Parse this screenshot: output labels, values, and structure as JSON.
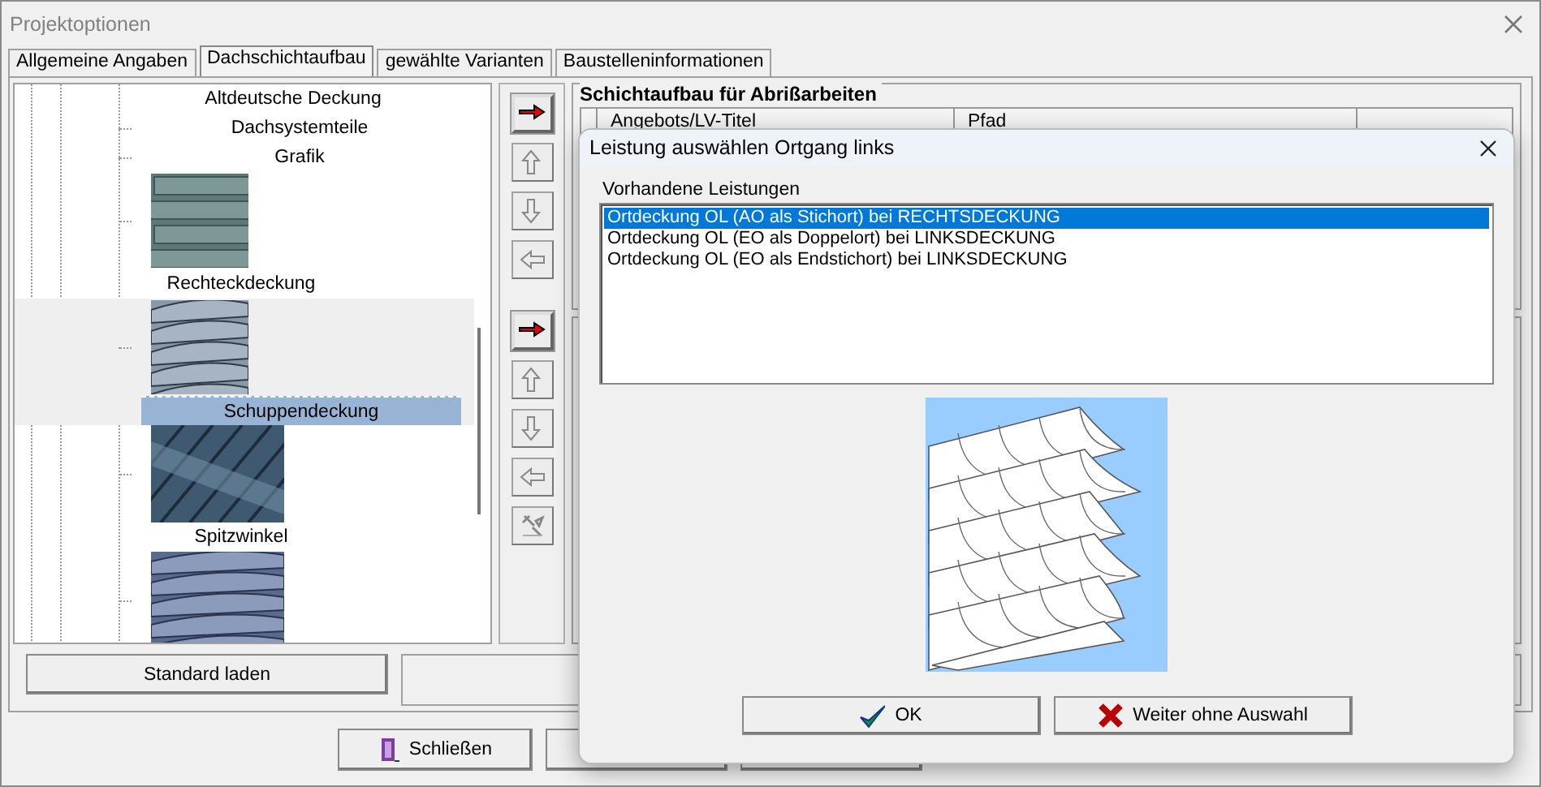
{
  "window": {
    "title": "Projektoptionen"
  },
  "tabs": [
    {
      "label": "Allgemeine Angaben",
      "selected": false
    },
    {
      "label": "Dachschichtaufbau",
      "selected": true
    },
    {
      "label": "gewählte Varianten",
      "selected": false
    },
    {
      "label": "Baustelleninformationen",
      "selected": false
    }
  ],
  "tree": {
    "items": [
      {
        "kind": "label",
        "label": "Altdeutsche Deckung",
        "selected": false
      },
      {
        "kind": "node",
        "label": "Dachsystemteile",
        "selected": false
      },
      {
        "kind": "node",
        "label": "Grafik",
        "selected": false
      },
      {
        "kind": "entry",
        "label": "Rechteckdeckung",
        "selected": false
      },
      {
        "kind": "entry",
        "label": "Schuppendeckung",
        "selected": true
      },
      {
        "kind": "entry",
        "label": "Spitzwinkel",
        "selected": false
      },
      {
        "kind": "picture",
        "selected": false
      }
    ]
  },
  "side_buttons": [
    {
      "kind": "add",
      "disabled": false
    },
    {
      "kind": "up",
      "disabled": true
    },
    {
      "kind": "down",
      "disabled": true
    },
    {
      "kind": "remove",
      "disabled": true
    },
    {
      "kind": "gap"
    },
    {
      "kind": "add",
      "disabled": false
    },
    {
      "kind": "up",
      "disabled": true
    },
    {
      "kind": "down",
      "disabled": true
    },
    {
      "kind": "remove",
      "disabled": true
    },
    {
      "kind": "tools",
      "disabled": true
    }
  ],
  "layer_group": {
    "title": "Schichtaufbau für Abrißarbeiten",
    "columns": [
      "Angebots/LV-Titel",
      "Pfad"
    ]
  },
  "standard_button": "Standard laden",
  "footer_button": "Schließen",
  "dialog": {
    "title": "Leistung auswählen Ortgang links",
    "list_label": "Vorhandene Leistungen",
    "options": [
      {
        "label": "Ortdeckung OL (AO als Stichort) bei RECHTSDECKUNG",
        "selected": true
      },
      {
        "label": "Ortdeckung OL (EO als Doppelort) bei LINKSDECKUNG",
        "selected": false
      },
      {
        "label": "Ortdeckung OL (EO als Endstichort) bei LINKSDECKUNG",
        "selected": false
      }
    ],
    "buttons": [
      {
        "kind": "ok",
        "label": "OK"
      },
      {
        "kind": "skip",
        "label": "Weiter ohne Auswahl"
      }
    ]
  }
}
